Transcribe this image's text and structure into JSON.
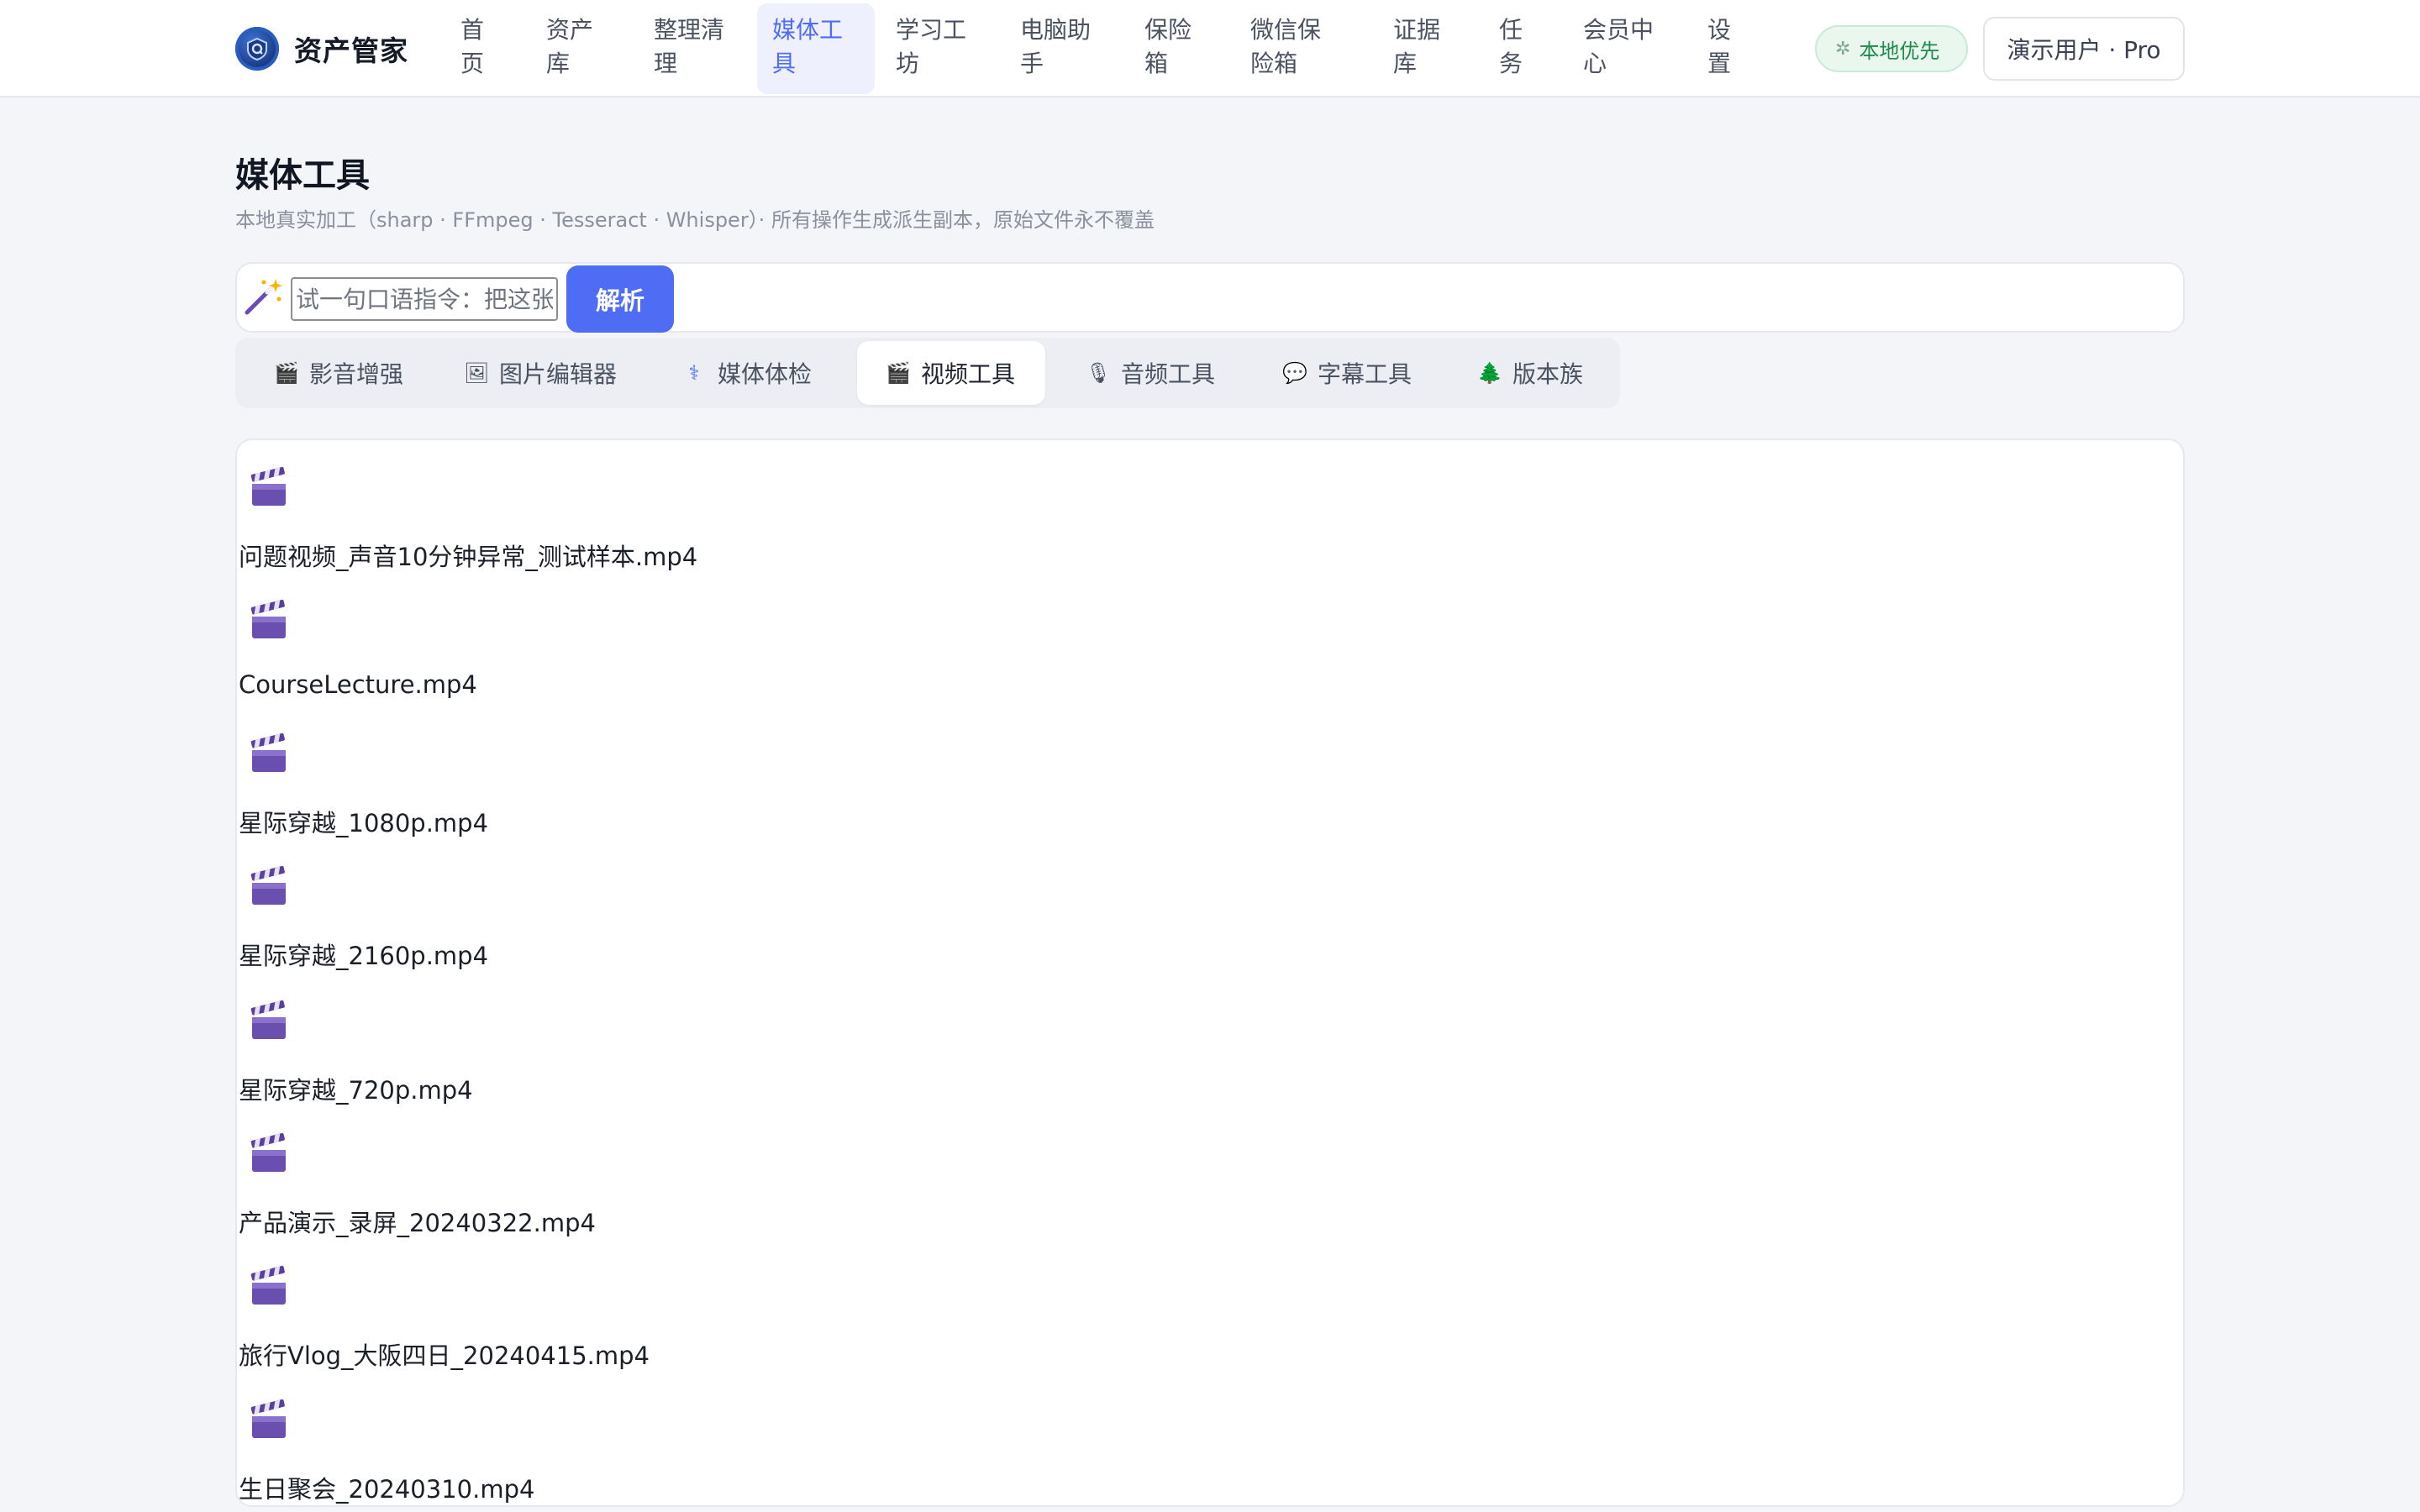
{
  "app": {
    "title": "资产管家"
  },
  "nav": {
    "items": [
      {
        "label": "首页",
        "lines": [
          "首",
          "页"
        ]
      },
      {
        "label": "资产库",
        "lines": [
          "资产",
          "库"
        ]
      },
      {
        "label": "整理清理",
        "lines": [
          "整理清",
          "理"
        ]
      },
      {
        "label": "媒体工具",
        "lines": [
          "媒体工",
          "具"
        ],
        "active": true
      },
      {
        "label": "学习工坊",
        "lines": [
          "学习工",
          "坊"
        ]
      },
      {
        "label": "电脑助手",
        "lines": [
          "电脑助",
          "手"
        ]
      },
      {
        "label": "保险箱",
        "lines": [
          "保险",
          "箱"
        ]
      },
      {
        "label": "微信保险箱",
        "lines": [
          "微信保",
          "险箱"
        ]
      },
      {
        "label": "证据库",
        "lines": [
          "证据",
          "库"
        ]
      },
      {
        "label": "任务",
        "lines": [
          "任",
          "务"
        ]
      },
      {
        "label": "会员中心",
        "lines": [
          "会员中",
          "心"
        ]
      },
      {
        "label": "设置",
        "lines": [
          "设",
          "置"
        ]
      }
    ],
    "badge": "本地优先",
    "user": "演示用户 · Pro"
  },
  "page": {
    "title": "媒体工具",
    "subtitle": "本地真实加工（sharp · FFmpeg · Tesseract · Whisper）· 所有操作生成派生副本，原始文件永不覆盖"
  },
  "command": {
    "placeholder": "试一句口语指令：把这张",
    "button": "解析"
  },
  "tabs": [
    {
      "label": "影音增强",
      "icon": "clapper-icon"
    },
    {
      "label": "图片编辑器",
      "icon": "picture-icon"
    },
    {
      "label": "媒体体检",
      "icon": "stethoscope-icon"
    },
    {
      "label": "视频工具",
      "icon": "clapper-icon",
      "active": true
    },
    {
      "label": "音频工具",
      "icon": "microphone-icon"
    },
    {
      "label": "字幕工具",
      "icon": "speech-bubble-icon"
    },
    {
      "label": "版本族",
      "icon": "tree-icon"
    }
  ],
  "files": [
    "问题视频_声音10分钟异常_测试样本.mp4",
    "CourseLecture.mp4",
    "星际穿越_1080p.mp4",
    "星际穿越_2160p.mp4",
    "星际穿越_720p.mp4",
    "产品演示_录屏_20240322.mp4",
    "旅行Vlog_大阪四日_20240415.mp4",
    "生日聚会_20240310.mp4"
  ],
  "colors": {
    "accent": "#4f6cf5",
    "badge_green": "#1f8a4c",
    "background": "#f4f5f8"
  }
}
